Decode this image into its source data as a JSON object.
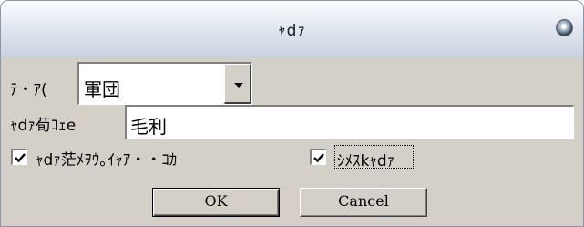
{
  "window": {
    "title": "ｬdｧ",
    "close_icon": "close-orb-icon"
  },
  "form": {
    "field1_label": "ﾃ・ｱ(",
    "field1_value": "軍団",
    "field2_label": "ｬdｧ荀ｺｪe",
    "field2_value": "毛利",
    "checkbox1_label": "ｬdｧ茫ﾒｦｳ｡ｲｬｱ・・ｺｶ",
    "checkbox1_checked": true,
    "checkbox2_label": "ｼﾒｽkｬdｧ",
    "checkbox2_checked": true
  },
  "buttons": {
    "ok_label": "OK",
    "cancel_label": "Cancel"
  }
}
